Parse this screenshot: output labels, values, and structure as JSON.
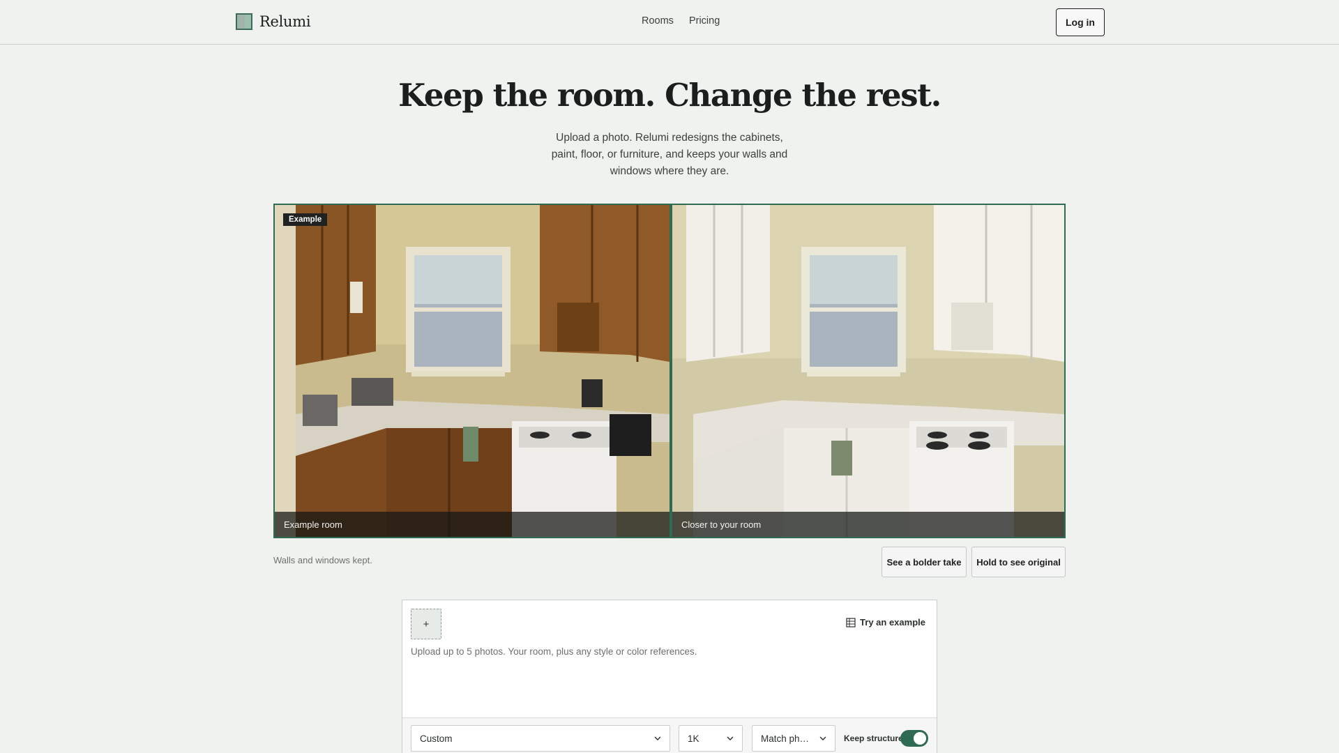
{
  "brand": {
    "name": "Relumi"
  },
  "nav": {
    "items": [
      "Rooms",
      "Pricing"
    ],
    "login_label": "Log in"
  },
  "hero": {
    "title": "Keep the room. Change the rest.",
    "subtitle": "Upload a photo. Relumi redesigns the cabinets, paint, floor, or furniture, and keeps your walls and windows where they are."
  },
  "comparison": {
    "badge": "Example",
    "left_caption": "Example room",
    "right_caption": "Closer to your room",
    "note": "Walls and windows kept.",
    "bolder_label": "See a bolder take",
    "hold_label": "Hold to see original"
  },
  "composer": {
    "add_symbol": "+",
    "try_label": "Try an example",
    "hint": "Upload up to 5 photos. Your room, plus any style or color references.",
    "style_value": "Custom",
    "resolution_value": "1K",
    "match_value": "Match ph…",
    "keep_structure_label": "Keep structure",
    "keep_structure_on": true
  },
  "colors": {
    "accent": "#2f6b53",
    "background": "#f0f2f0"
  }
}
